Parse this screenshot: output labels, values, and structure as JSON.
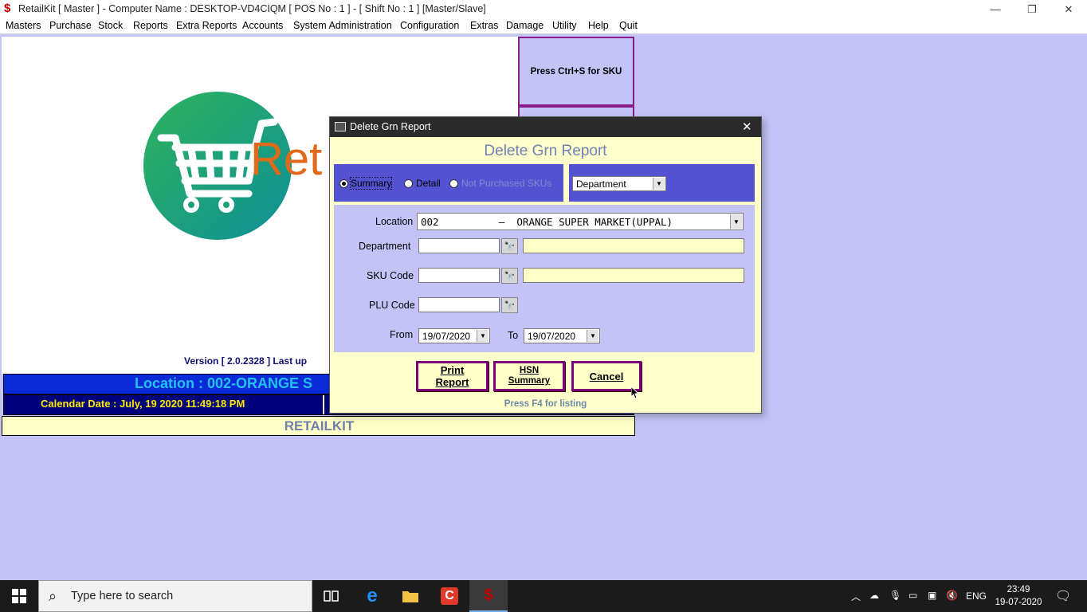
{
  "window": {
    "app_icon": "$",
    "title": "RetailKit [ Master ] - Computer Name : DESKTOP-VD4CIQM [ POS No : 1 ] - [ Shift No : 1 ]  [Master/Slave]",
    "minimize_glyph": "—",
    "restore_glyph": "❐",
    "close_glyph": "✕"
  },
  "menu": [
    "Masters",
    "Purchase",
    "Stock",
    "Reports",
    "Extra Reports",
    "Accounts",
    "System Administration",
    "Configuration",
    "Extras",
    "Damage",
    "Utility",
    "Help",
    "Quit"
  ],
  "main": {
    "logo_text": "Ret",
    "version": "Version [ 2.0.2328 ]  Last up",
    "sku_hint": "Press Ctrl+S for SKU",
    "location_banner": "Location : 002-ORANGE S",
    "calendar": "Calendar Date : July, 19 2020 11:49:18 PM",
    "brand": "RETAILKIT"
  },
  "dialog": {
    "title": "Delete Grn Report",
    "close_glyph": "✕",
    "heading": "Delete Grn Report",
    "report_types": [
      {
        "label": "Summary",
        "checked": true,
        "enabled": true
      },
      {
        "label": "Detail",
        "checked": false,
        "enabled": true
      },
      {
        "label": "Not Purchased SKUs",
        "checked": false,
        "enabled": false
      }
    ],
    "group_by": "Department",
    "fields": {
      "location_label": "Location",
      "location_value": "002          –  ORANGE SUPER MARKET(UPPAL)",
      "department_label": "Department",
      "department_code": "",
      "department_desc": "",
      "sku_label": "SKU Code",
      "sku_code": "",
      "sku_desc": "",
      "plu_label": "PLU Code",
      "plu_code": "",
      "from_label": "From",
      "from_date": "19/07/2020",
      "to_label": "To",
      "to_date": "19/07/2020"
    },
    "buttons": {
      "print_line1": "Print",
      "print_line2": "Report",
      "hsn_line1": "HSN",
      "hsn_line2": "Summary",
      "cancel": "Cancel"
    },
    "hint": "Press F4 for listing",
    "dropdown_glyph": "▼",
    "find_glyph": "🔭"
  },
  "taskbar": {
    "search_placeholder": "Type here to search",
    "language": "ENG",
    "time": "23:49",
    "date": "19-07-2020",
    "colors": {
      "background": "#1b1b1b",
      "active_app": "#c00000"
    }
  }
}
